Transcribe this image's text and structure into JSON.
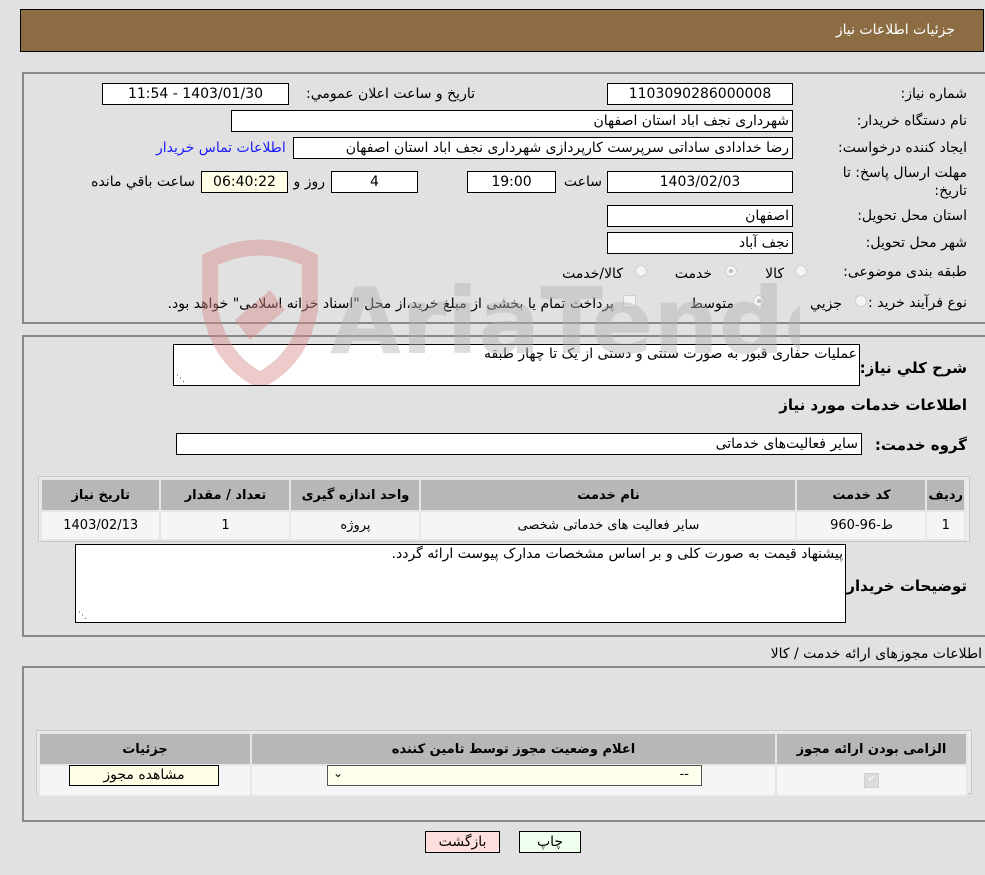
{
  "header": {
    "title": "جزئيات اطلاعات نياز"
  },
  "details": {
    "need_number_label": "شماره نياز:",
    "need_number": "1103090286000008",
    "announce_label": "تاريخ و ساعت اعلان عمومي:",
    "announce_value": "1403/01/30 - 11:54",
    "buyer_org_label": "نام دستگاه خريدار:",
    "buyer_org": "شهرداری نجف اباد استان اصفهان",
    "creator_label": "ايجاد کننده درخواست:",
    "creator": "رضا خدادادی ساداتی سرپرست  کارپردازی شهرداری نجف اباد استان اصفهان",
    "contact_link": "اطلاعات تماس خريدار",
    "deadline_label_1": "مهلت ارسال پاسخ: تا",
    "deadline_label_2": "تاريخ:",
    "deadline_date": "1403/02/03",
    "time_label": "ساعت",
    "deadline_time": "19:00",
    "days": "4",
    "days_label": "روز و",
    "remaining": "06:40:22",
    "remaining_label": "ساعت باقي مانده",
    "province_label": "استان محل تحويل:",
    "province": "اصفهان",
    "city_label": "شهر محل تحويل:",
    "city": "نجف آباد",
    "category_label": "طبقه بندی موضوعی:",
    "category_options": [
      {
        "label": "کالا",
        "selected": false
      },
      {
        "label": "خدمت",
        "selected": true
      },
      {
        "label": "کالا/خدمت",
        "selected": false
      }
    ],
    "process_label": "نوع فرآيند خريد :",
    "process_options": [
      {
        "label": "جزيي",
        "selected": false
      },
      {
        "label": "متوسط",
        "selected": true
      }
    ],
    "treasury_note": "پرداخت تمام يا بخشی از مبلغ خريد،از محل \"اسناد خزانه اسلامی\" خواهد بود."
  },
  "services": {
    "summary_label": "شرح کلي نياز:",
    "summary": "عمليات حفاری قبور به صورت سنتی و دستی از يک تا چهار طبقه",
    "section_title": "اطلاعات خدمات مورد نياز",
    "group_label": "گروه خدمت:",
    "group": "ساير فعاليت‌های خدماتی",
    "table": {
      "headers": [
        "رديف",
        "کد خدمت",
        "نام خدمت",
        "واحد اندازه گيری",
        "تعداد / مقدار",
        "تاريخ نياز"
      ],
      "rows": [
        [
          "1",
          "ط-96-960",
          "ساير فعاليت های خدماتی شخصی",
          "پروژه",
          "1",
          "1403/02/13"
        ]
      ]
    },
    "buyer_notes_label": "توضيحات خريدار:",
    "buyer_notes": "پيشنهاد قيمت به صورت کلی و بر اساس مشخصات مدارک پيوست ارائه گردد."
  },
  "permits": {
    "section_title": "اطلاعات مجوزهای ارائه خدمت / کالا",
    "headers": [
      "الزامی بودن ارائه مجوز",
      "اعلام وضعيت مجوز توسط تامين کننده",
      "جزئيات"
    ],
    "row": {
      "required": true,
      "status_value": "--",
      "view_button": "مشاهده مجوز"
    }
  },
  "footer": {
    "print_button": "چاپ",
    "back_button": "بازگشت"
  },
  "watermark": {
    "text": "AriaTender.neT"
  }
}
